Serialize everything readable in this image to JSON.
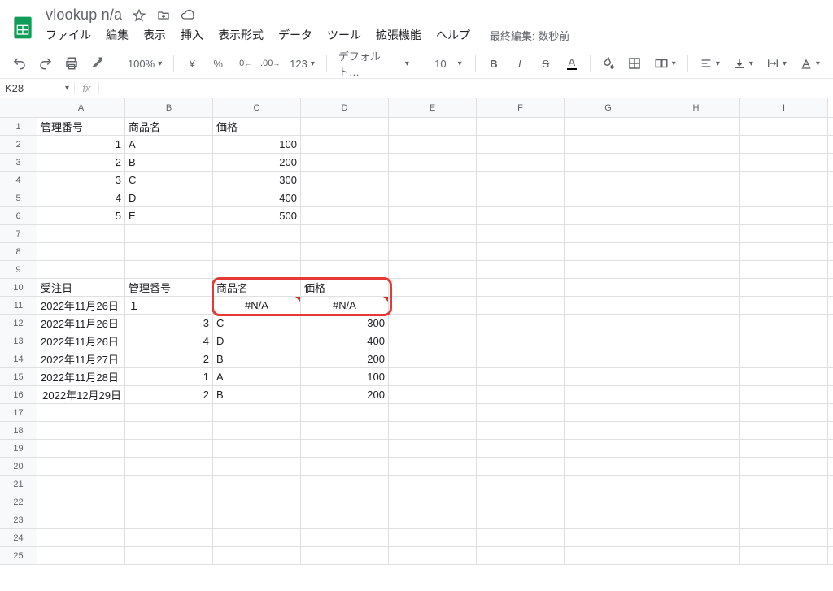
{
  "doc": {
    "title": "vlookup n/a"
  },
  "menus": [
    "ファイル",
    "編集",
    "表示",
    "挿入",
    "表示形式",
    "データ",
    "ツール",
    "拡張機能",
    "ヘルプ"
  ],
  "last_edit": "最終編集: 数秒前",
  "toolbar": {
    "zoom": "100%",
    "currency": "¥",
    "percent": "%",
    "dec_dec": ".0",
    "dec_inc": ".00",
    "more_fmt": "123",
    "font": "デフォルト…",
    "font_size": "10"
  },
  "fx": {
    "namebox": "K28",
    "fx_label": "fx",
    "formula": ""
  },
  "sheet": {
    "columns": [
      "A",
      "B",
      "C",
      "D",
      "E",
      "F",
      "G",
      "H",
      "I"
    ],
    "rows": [
      {
        "n": 1,
        "cells": [
          {
            "v": "管理番号"
          },
          {
            "v": "商品名"
          },
          {
            "v": "価格"
          },
          {
            "v": ""
          },
          {
            "v": ""
          },
          {
            "v": ""
          },
          {
            "v": ""
          },
          {
            "v": ""
          },
          {
            "v": ""
          }
        ]
      },
      {
        "n": 2,
        "cells": [
          {
            "v": "1",
            "a": "right"
          },
          {
            "v": "A"
          },
          {
            "v": "100",
            "a": "right"
          },
          {
            "v": ""
          },
          {
            "v": ""
          },
          {
            "v": ""
          },
          {
            "v": ""
          },
          {
            "v": ""
          },
          {
            "v": ""
          }
        ]
      },
      {
        "n": 3,
        "cells": [
          {
            "v": "2",
            "a": "right"
          },
          {
            "v": "B"
          },
          {
            "v": "200",
            "a": "right"
          },
          {
            "v": ""
          },
          {
            "v": ""
          },
          {
            "v": ""
          },
          {
            "v": ""
          },
          {
            "v": ""
          },
          {
            "v": ""
          }
        ]
      },
      {
        "n": 4,
        "cells": [
          {
            "v": "3",
            "a": "right"
          },
          {
            "v": "C"
          },
          {
            "v": "300",
            "a": "right"
          },
          {
            "v": ""
          },
          {
            "v": ""
          },
          {
            "v": ""
          },
          {
            "v": ""
          },
          {
            "v": ""
          },
          {
            "v": ""
          }
        ]
      },
      {
        "n": 5,
        "cells": [
          {
            "v": "4",
            "a": "right"
          },
          {
            "v": "D"
          },
          {
            "v": "400",
            "a": "right"
          },
          {
            "v": ""
          },
          {
            "v": ""
          },
          {
            "v": ""
          },
          {
            "v": ""
          },
          {
            "v": ""
          },
          {
            "v": ""
          }
        ]
      },
      {
        "n": 6,
        "cells": [
          {
            "v": "5",
            "a": "right"
          },
          {
            "v": "E"
          },
          {
            "v": "500",
            "a": "right"
          },
          {
            "v": ""
          },
          {
            "v": ""
          },
          {
            "v": ""
          },
          {
            "v": ""
          },
          {
            "v": ""
          },
          {
            "v": ""
          }
        ]
      },
      {
        "n": 7,
        "cells": [
          {
            "v": ""
          },
          {
            "v": ""
          },
          {
            "v": ""
          },
          {
            "v": ""
          },
          {
            "v": ""
          },
          {
            "v": ""
          },
          {
            "v": ""
          },
          {
            "v": ""
          },
          {
            "v": ""
          }
        ]
      },
      {
        "n": 8,
        "cells": [
          {
            "v": ""
          },
          {
            "v": ""
          },
          {
            "v": ""
          },
          {
            "v": ""
          },
          {
            "v": ""
          },
          {
            "v": ""
          },
          {
            "v": ""
          },
          {
            "v": ""
          },
          {
            "v": ""
          }
        ]
      },
      {
        "n": 9,
        "cells": [
          {
            "v": ""
          },
          {
            "v": ""
          },
          {
            "v": ""
          },
          {
            "v": ""
          },
          {
            "v": ""
          },
          {
            "v": ""
          },
          {
            "v": ""
          },
          {
            "v": ""
          },
          {
            "v": ""
          }
        ]
      },
      {
        "n": 10,
        "cells": [
          {
            "v": "受注日"
          },
          {
            "v": "管理番号"
          },
          {
            "v": "商品名"
          },
          {
            "v": "価格"
          },
          {
            "v": ""
          },
          {
            "v": ""
          },
          {
            "v": ""
          },
          {
            "v": ""
          },
          {
            "v": ""
          }
        ]
      },
      {
        "n": 11,
        "cells": [
          {
            "v": "2022年11月26日"
          },
          {
            "v": "１"
          },
          {
            "v": "#N/A",
            "a": "center",
            "err": true
          },
          {
            "v": "#N/A",
            "a": "center",
            "err": true
          },
          {
            "v": ""
          },
          {
            "v": ""
          },
          {
            "v": ""
          },
          {
            "v": ""
          },
          {
            "v": ""
          }
        ]
      },
      {
        "n": 12,
        "cells": [
          {
            "v": "2022年11月26日"
          },
          {
            "v": "3",
            "a": "right"
          },
          {
            "v": "C"
          },
          {
            "v": "300",
            "a": "right"
          },
          {
            "v": ""
          },
          {
            "v": ""
          },
          {
            "v": ""
          },
          {
            "v": ""
          },
          {
            "v": ""
          }
        ]
      },
      {
        "n": 13,
        "cells": [
          {
            "v": "2022年11月26日"
          },
          {
            "v": "4",
            "a": "right"
          },
          {
            "v": "D"
          },
          {
            "v": "400",
            "a": "right"
          },
          {
            "v": ""
          },
          {
            "v": ""
          },
          {
            "v": ""
          },
          {
            "v": ""
          },
          {
            "v": ""
          }
        ]
      },
      {
        "n": 14,
        "cells": [
          {
            "v": "2022年11月27日"
          },
          {
            "v": "2",
            "a": "right"
          },
          {
            "v": "B"
          },
          {
            "v": "200",
            "a": "right"
          },
          {
            "v": ""
          },
          {
            "v": ""
          },
          {
            "v": ""
          },
          {
            "v": ""
          },
          {
            "v": ""
          }
        ]
      },
      {
        "n": 15,
        "cells": [
          {
            "v": "2022年11月28日"
          },
          {
            "v": "1",
            "a": "right"
          },
          {
            "v": "A"
          },
          {
            "v": "100",
            "a": "right"
          },
          {
            "v": ""
          },
          {
            "v": ""
          },
          {
            "v": ""
          },
          {
            "v": ""
          },
          {
            "v": ""
          }
        ]
      },
      {
        "n": 16,
        "cells": [
          {
            "v": "2022年12月29日",
            "a": "right"
          },
          {
            "v": "2",
            "a": "right"
          },
          {
            "v": "B"
          },
          {
            "v": "200",
            "a": "right"
          },
          {
            "v": ""
          },
          {
            "v": ""
          },
          {
            "v": ""
          },
          {
            "v": ""
          },
          {
            "v": ""
          }
        ]
      },
      {
        "n": 17,
        "cells": [
          {
            "v": ""
          },
          {
            "v": ""
          },
          {
            "v": ""
          },
          {
            "v": ""
          },
          {
            "v": ""
          },
          {
            "v": ""
          },
          {
            "v": ""
          },
          {
            "v": ""
          },
          {
            "v": ""
          }
        ]
      },
      {
        "n": 18,
        "cells": [
          {
            "v": ""
          },
          {
            "v": ""
          },
          {
            "v": ""
          },
          {
            "v": ""
          },
          {
            "v": ""
          },
          {
            "v": ""
          },
          {
            "v": ""
          },
          {
            "v": ""
          },
          {
            "v": ""
          }
        ]
      },
      {
        "n": 19,
        "cells": [
          {
            "v": ""
          },
          {
            "v": ""
          },
          {
            "v": ""
          },
          {
            "v": ""
          },
          {
            "v": ""
          },
          {
            "v": ""
          },
          {
            "v": ""
          },
          {
            "v": ""
          },
          {
            "v": ""
          }
        ]
      },
      {
        "n": 20,
        "cells": [
          {
            "v": ""
          },
          {
            "v": ""
          },
          {
            "v": ""
          },
          {
            "v": ""
          },
          {
            "v": ""
          },
          {
            "v": ""
          },
          {
            "v": ""
          },
          {
            "v": ""
          },
          {
            "v": ""
          }
        ]
      },
      {
        "n": 21,
        "cells": [
          {
            "v": ""
          },
          {
            "v": ""
          },
          {
            "v": ""
          },
          {
            "v": ""
          },
          {
            "v": ""
          },
          {
            "v": ""
          },
          {
            "v": ""
          },
          {
            "v": ""
          },
          {
            "v": ""
          }
        ]
      },
      {
        "n": 22,
        "cells": [
          {
            "v": ""
          },
          {
            "v": ""
          },
          {
            "v": ""
          },
          {
            "v": ""
          },
          {
            "v": ""
          },
          {
            "v": ""
          },
          {
            "v": ""
          },
          {
            "v": ""
          },
          {
            "v": ""
          }
        ]
      },
      {
        "n": 23,
        "cells": [
          {
            "v": ""
          },
          {
            "v": ""
          },
          {
            "v": ""
          },
          {
            "v": ""
          },
          {
            "v": ""
          },
          {
            "v": ""
          },
          {
            "v": ""
          },
          {
            "v": ""
          },
          {
            "v": ""
          }
        ]
      },
      {
        "n": 24,
        "cells": [
          {
            "v": ""
          },
          {
            "v": ""
          },
          {
            "v": ""
          },
          {
            "v": ""
          },
          {
            "v": ""
          },
          {
            "v": ""
          },
          {
            "v": ""
          },
          {
            "v": ""
          },
          {
            "v": ""
          }
        ]
      },
      {
        "n": 25,
        "cells": [
          {
            "v": ""
          },
          {
            "v": ""
          },
          {
            "v": ""
          },
          {
            "v": ""
          },
          {
            "v": ""
          },
          {
            "v": ""
          },
          {
            "v": ""
          },
          {
            "v": ""
          },
          {
            "v": ""
          }
        ]
      }
    ]
  }
}
